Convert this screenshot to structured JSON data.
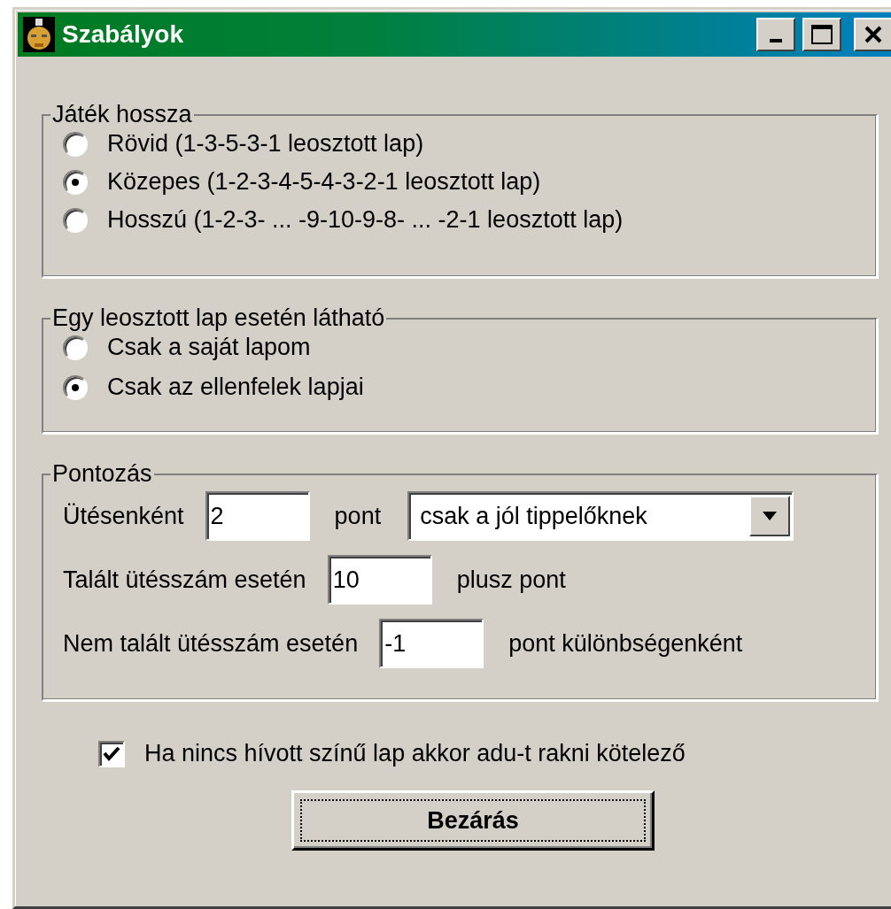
{
  "window": {
    "title": "Szabályok"
  },
  "game_length": {
    "title": "Játék hossza",
    "options": [
      {
        "label": "Rövid (1-3-5-3-1 leosztott lap)",
        "selected": false
      },
      {
        "label": "Közepes (1-2-3-4-5-4-3-2-1 leosztott lap)",
        "selected": true
      },
      {
        "label": "Hosszú (1-2-3- ... -9-10-9-8- ... -2-1 leosztott lap)",
        "selected": false
      }
    ]
  },
  "visibility": {
    "title": "Egy leosztott lap esetén látható",
    "options": [
      {
        "label": "Csak a saját lapom",
        "selected": false
      },
      {
        "label": "Csak az ellenfelek lapjai",
        "selected": true
      }
    ]
  },
  "scoring": {
    "title": "Pontozás",
    "rows": [
      {
        "label": "Ütésenként",
        "value": "2",
        "suffix": "pont",
        "dropdown": "csak a jól tippelőknek"
      },
      {
        "label": "Talált ütésszám esetén",
        "value": "10",
        "suffix": "plusz pont"
      },
      {
        "label": "Nem talált ütésszám esetén",
        "value": "-1",
        "suffix": "pont különbségenként"
      }
    ]
  },
  "trump_rule": {
    "label": "Ha nincs hívott színű lap akkor adu-t rakni kötelező",
    "checked": true
  },
  "close_button": "Bezárás"
}
